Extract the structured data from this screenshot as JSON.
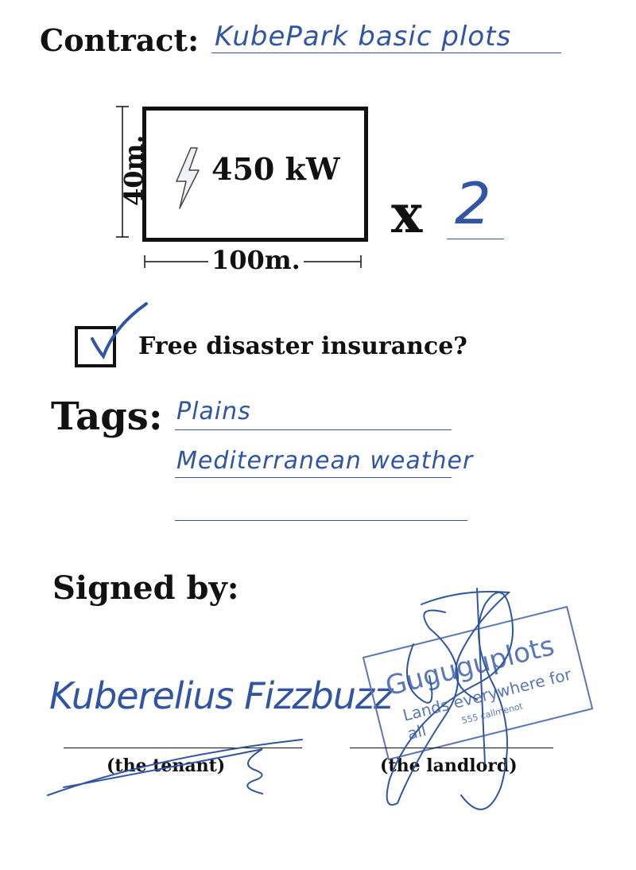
{
  "contract": {
    "label": "Contract:",
    "value": "KubePark basic plots"
  },
  "plot": {
    "power": "450 kW",
    "height": "40m.",
    "width": "100m.",
    "multiply_symbol": "x",
    "quantity": "2",
    "bolt_icon": "lightning-bolt-icon"
  },
  "insurance": {
    "label": "Free disaster insurance?",
    "checked": true
  },
  "tags": {
    "label": "Tags:",
    "items": [
      "Plains",
      "Mediterranean weather",
      ""
    ]
  },
  "signatures": {
    "label": "Signed by:",
    "tenant": {
      "signature": "Kuberelius Fizzbuzz",
      "role": "(the tenant)"
    },
    "landlord": {
      "role": "(the landlord)",
      "stamp": {
        "name": "Guguguplots",
        "motto": "Lands everywhere for all",
        "phone": "555 callmenot"
      }
    }
  },
  "colors": {
    "ink": "#111111",
    "pen_blue": "#2f55a4",
    "stamp_blue": "#5a77b8"
  }
}
